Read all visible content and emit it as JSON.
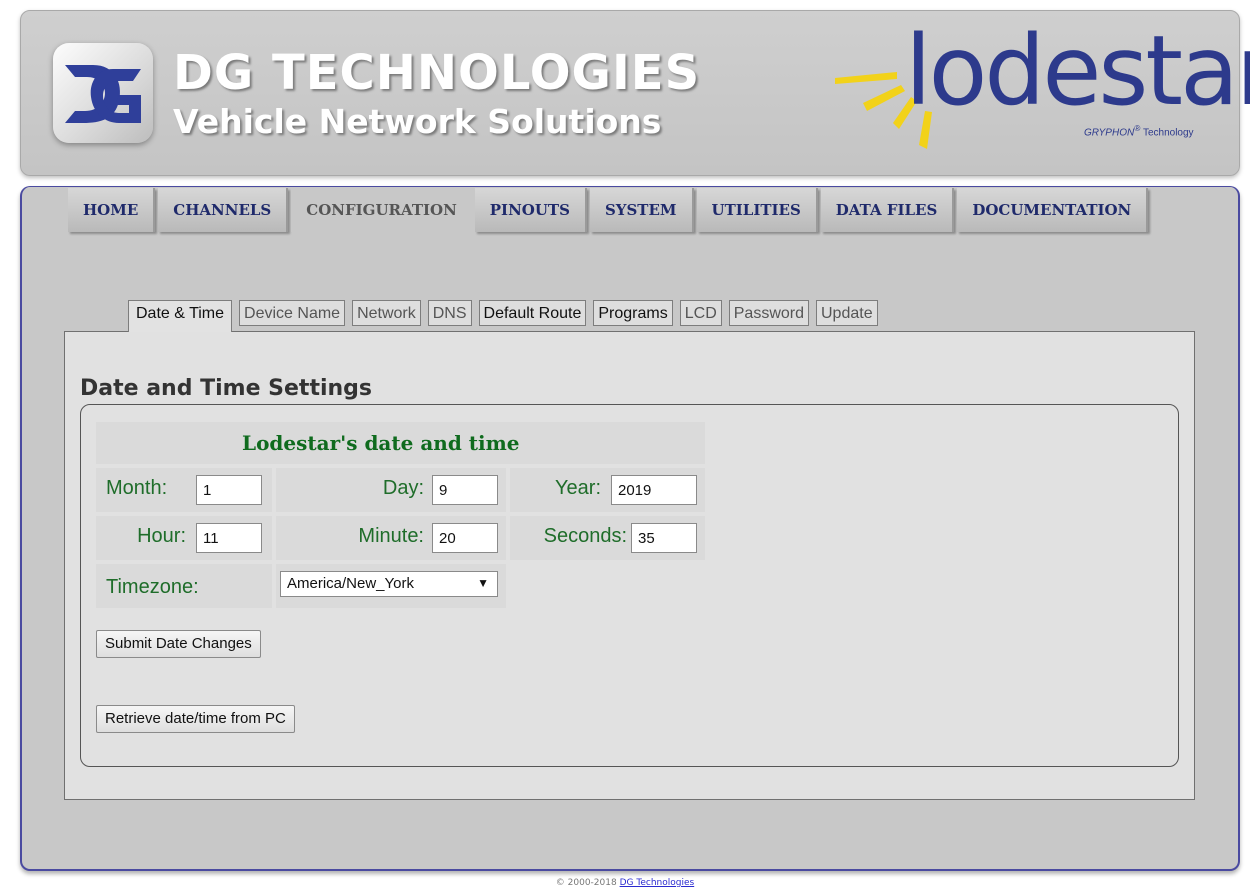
{
  "header": {
    "brand_title": "DG TECHNOLOGIES",
    "brand_subtitle": "Vehicle Network Solutions",
    "product_logo_text": "lodestar",
    "product_tagline_brand": "GRYPHON",
    "product_tagline_mark": "®",
    "product_tagline_suffix": "Technology"
  },
  "nav": {
    "tabs": [
      {
        "label": "HOME"
      },
      {
        "label": "CHANNELS"
      },
      {
        "label": "CONFIGURATION",
        "active": true
      },
      {
        "label": "PINOUTS"
      },
      {
        "label": "SYSTEM"
      },
      {
        "label": "UTILITIES"
      },
      {
        "label": "DATA FILES"
      },
      {
        "label": "DOCUMENTATION"
      }
    ]
  },
  "subtabs": {
    "items": [
      {
        "label": "Date & Time",
        "active": true
      },
      {
        "label": "Device Name"
      },
      {
        "label": "Network"
      },
      {
        "label": "DNS"
      },
      {
        "label": "Default Route"
      },
      {
        "label": "Programs"
      },
      {
        "label": "LCD"
      },
      {
        "label": "Password"
      },
      {
        "label": "Update"
      }
    ]
  },
  "page": {
    "section_title": "Date and Time Settings",
    "box_title": "Lodestar's date and time"
  },
  "form": {
    "month_label": "Month:",
    "month_value": "1",
    "day_label": "Day:",
    "day_value": "9",
    "year_label": "Year:",
    "year_value": "2019",
    "hour_label": "Hour:",
    "hour_value": "11",
    "minute_label": "Minute:",
    "minute_value": "20",
    "seconds_label": "Seconds:",
    "seconds_value": "35",
    "timezone_label": "Timezone:",
    "timezone_value": "America/New_York",
    "submit_label": "Submit Date Changes",
    "retrieve_label": "Retrieve date/time from PC"
  },
  "footer": {
    "copyright": "© 2000-2018",
    "link_text": "DG Technologies"
  },
  "colors": {
    "nav_text": "#1f2a6b",
    "label_green": "#1f6d2a",
    "lodestar_blue": "#2d3a8c",
    "ray_yellow": "#f2d21a",
    "panel_border": "#4a4aa0"
  },
  "icons": {
    "dg_logo": "dg-logo-icon",
    "lodestar_rays": "sun-rays-icon",
    "select_arrow": "dropdown-arrow-icon"
  }
}
